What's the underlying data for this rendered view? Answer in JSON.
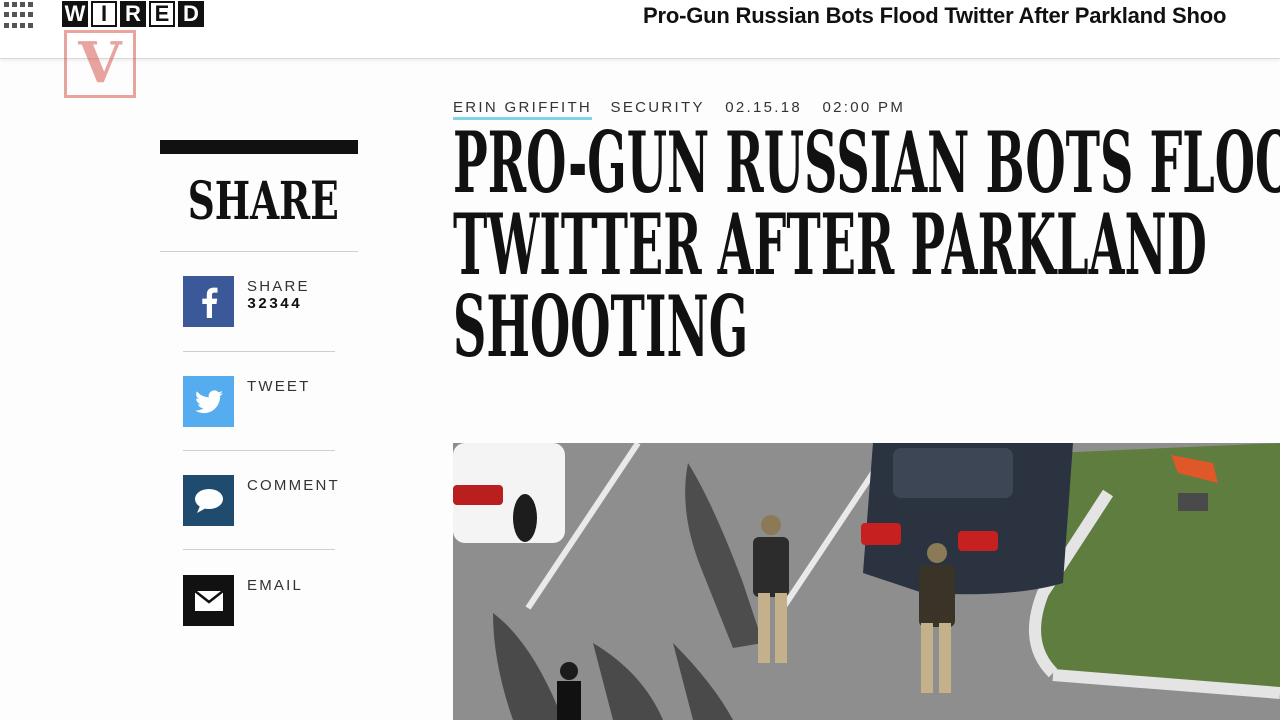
{
  "topbar": {
    "logo_letters": [
      "W",
      "I",
      "R",
      "E",
      "D"
    ],
    "title": "Pro-Gun Russian Bots Flood Twitter After Parkland Shoo"
  },
  "watermark": {
    "letter": "V"
  },
  "share": {
    "heading": "SHARE",
    "items": [
      {
        "label": "SHARE",
        "count": "32344",
        "icon": "facebook-icon",
        "color": "#3b5998"
      },
      {
        "label": "TWEET",
        "icon": "twitter-icon",
        "color": "#55acee"
      },
      {
        "label": "COMMENT",
        "icon": "comment-icon",
        "color": "#1f4b6e"
      },
      {
        "label": "EMAIL",
        "icon": "email-icon",
        "color": "#111111"
      }
    ]
  },
  "article": {
    "author": "ERIN GRIFFITH",
    "section": "SECURITY",
    "date": "02.15.18",
    "time": "02:00 PM",
    "headline_lines": [
      "PRO-GUN RUSSIAN BOTS FLOOD",
      "TWITTER AFTER PARKLAND",
      "SHOOTING"
    ],
    "hero_image": "aerial-photo-parking-lot-police"
  },
  "colors": {
    "accent": "#7fd5e6",
    "text": "#111111"
  }
}
